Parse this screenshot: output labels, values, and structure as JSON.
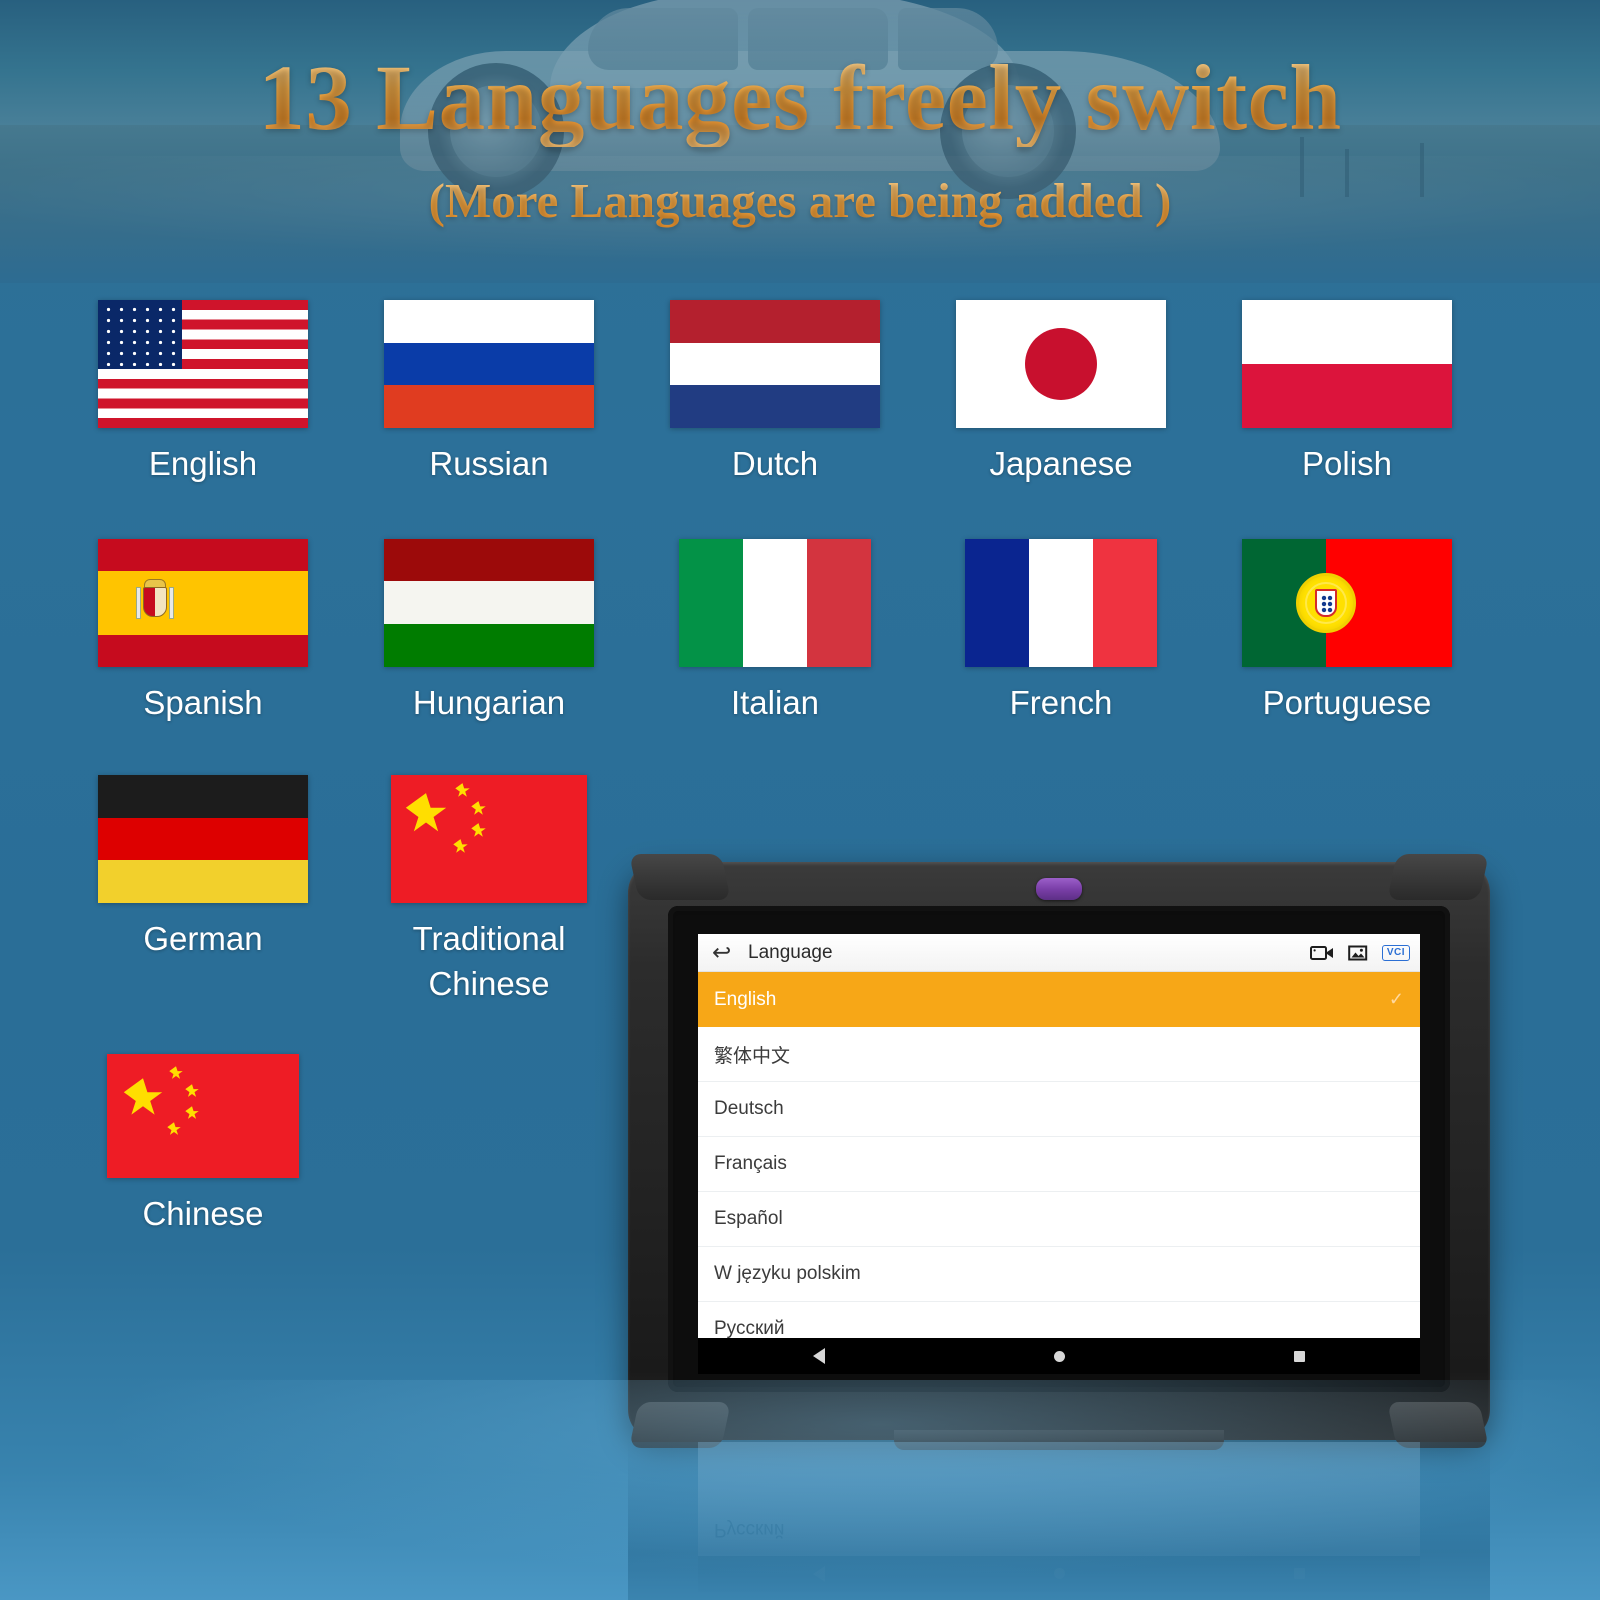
{
  "hero": {
    "title": "13 Languages freely switch",
    "subtitle": "(More Languages are being added )",
    "title_color": "#f0a23c"
  },
  "flag_grid": {
    "rows": [
      [
        {
          "label": "English",
          "flag": "us-flag"
        },
        {
          "label": "Russian",
          "flag": "russia-flag"
        },
        {
          "label": "Dutch",
          "flag": "netherlands-flag"
        },
        {
          "label": "Japanese",
          "flag": "japan-flag"
        },
        {
          "label": "Polish",
          "flag": "poland-flag"
        }
      ],
      [
        {
          "label": "Spanish",
          "flag": "spain-flag"
        },
        {
          "label": "Hungarian",
          "flag": "hungary-flag"
        },
        {
          "label": "Italian",
          "flag": "italy-flag"
        },
        {
          "label": "French",
          "flag": "france-flag"
        },
        {
          "label": "Portuguese",
          "flag": "portugal-flag"
        }
      ],
      [
        {
          "label": "German",
          "flag": "germany-flag"
        },
        {
          "label": "Traditional Chinese",
          "flag": "china-flag"
        }
      ],
      [
        {
          "label": "Chinese",
          "flag": "china-flag"
        }
      ]
    ]
  },
  "tablet": {
    "screen": {
      "titlebar": {
        "back_icon": "↩",
        "title": "Language",
        "icons": [
          "video-camera-icon",
          "screenshot-icon",
          "vci-badge"
        ],
        "vci_label": "VCI"
      },
      "languages": [
        {
          "label": "English",
          "selected": true,
          "check": "✓"
        },
        {
          "label": "繁体中文",
          "selected": false
        },
        {
          "label": "Deutsch",
          "selected": false
        },
        {
          "label": "Français",
          "selected": false
        },
        {
          "label": "Español",
          "selected": false
        },
        {
          "label": "W języku polskim",
          "selected": false
        },
        {
          "label": "Русский",
          "selected": false
        }
      ],
      "selected_color": "#f7a717",
      "navbar": [
        "back-nav-icon",
        "home-nav-icon",
        "recents-nav-icon"
      ]
    }
  },
  "reflection": {
    "text": "Русский"
  },
  "theme": {
    "background": "#2b6f98",
    "accent": "#f7a717"
  }
}
